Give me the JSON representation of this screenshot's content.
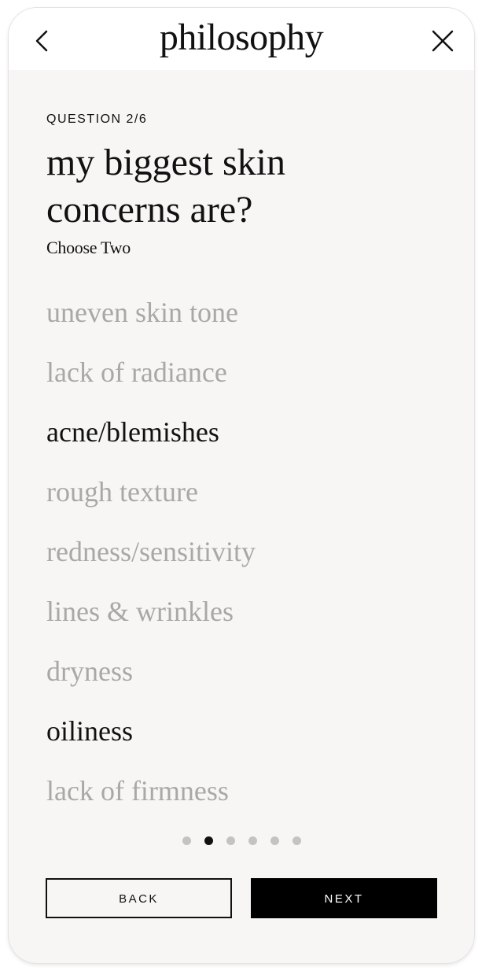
{
  "header": {
    "logo": "philosophy",
    "back_icon": "chevron-left-icon",
    "close_icon": "close-icon"
  },
  "quiz": {
    "question_number": "QUESTION 2/6",
    "title": "my biggest skin concerns are?",
    "subtitle": "Choose Two",
    "options": [
      {
        "label": "uneven skin tone",
        "selected": false
      },
      {
        "label": "lack of radiance",
        "selected": false
      },
      {
        "label": "acne/blemishes",
        "selected": true
      },
      {
        "label": "rough texture",
        "selected": false
      },
      {
        "label": "redness/sensitivity",
        "selected": false
      },
      {
        "label": "lines & wrinkles",
        "selected": false
      },
      {
        "label": "dryness",
        "selected": false
      },
      {
        "label": "oiliness",
        "selected": true
      },
      {
        "label": "lack of firmness",
        "selected": false
      }
    ]
  },
  "progress": {
    "total_steps": 6,
    "current_step": 2
  },
  "actions": {
    "back_label": "BACK",
    "next_label": "NEXT"
  },
  "colors": {
    "background": "#f7f6f4",
    "selected_text": "#111111",
    "unselected_text": "#a9a8a5",
    "primary_button": "#000000",
    "dot_inactive": "#c4c3c1"
  }
}
